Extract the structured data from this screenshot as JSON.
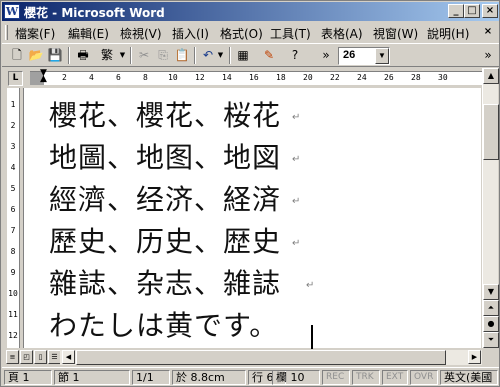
{
  "window": {
    "title": "櫻花 - Microsoft Word",
    "app_icon_letter": "W",
    "caption_buttons": {
      "minimize": "_",
      "maximize": "□",
      "close": "×"
    }
  },
  "menu": {
    "items": [
      "檔案(F)",
      "編輯(E)",
      "檢視(V)",
      "插入(I)",
      "格式(O)",
      "工具(T)",
      "表格(A)",
      "視窗(W)",
      "說明(H)"
    ],
    "doc_close": "×"
  },
  "toolbar": {
    "font_size": "26",
    "font_glyph": "繁",
    "overflow": "»",
    "icons": [
      "new-icon",
      "open-icon",
      "save-icon",
      "print-icon",
      "chinese-conversion-icon",
      "cut-icon",
      "copy-icon",
      "paste-icon",
      "undo-icon",
      "insert-table-icon",
      "drawing-icon",
      "help-icon"
    ]
  },
  "ruler": {
    "tab_selector": "L",
    "marks": [
      "2",
      "4",
      "6",
      "8",
      "10",
      "12",
      "14",
      "16",
      "18",
      "20",
      "22",
      "24",
      "26",
      "28",
      "30"
    ],
    "vertical_marks": [
      "1",
      "2",
      "3",
      "4",
      "5",
      "6",
      "7",
      "8",
      "9",
      "10",
      "11",
      "12"
    ]
  },
  "document": {
    "lines": [
      "櫻花、櫻花、桜花",
      "地圖、地图、地図",
      "經濟、经济、経済",
      "歷史、历史、歴史",
      "雜誌、杂志、雑誌",
      "わたしは黄です。"
    ],
    "paragraph_mark": "↵"
  },
  "status_bar": {
    "page": "頁 1",
    "section": "節 1",
    "page_of": "1/1",
    "position": "於 8.8cm",
    "line": "行 6",
    "column": "欄 10",
    "indicators": [
      "REC",
      "TRK",
      "EXT",
      "OVR"
    ],
    "language": "英文(美國"
  }
}
